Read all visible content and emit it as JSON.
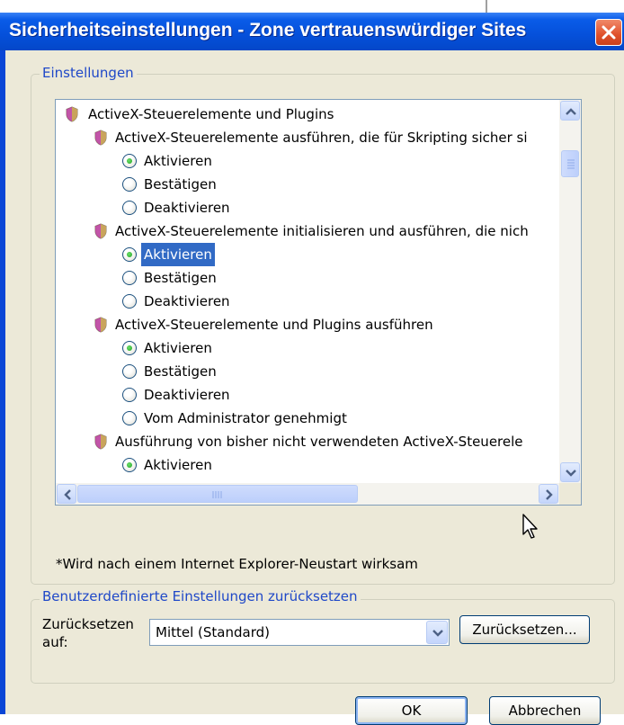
{
  "window": {
    "title": "Sicherheitseinstellungen - Zone vertrauenswürdiger Sites",
    "close_icon": "close-x-icon"
  },
  "settings_group": {
    "legend": "Einstellungen",
    "tree": [
      {
        "type": "category",
        "label": "ActiveX-Steuerelemente und Plugins",
        "icon": "shield-icon"
      },
      {
        "type": "setting",
        "label": "ActiveX-Steuerelemente ausführen, die für Skripting sicher si",
        "icon": "shield-icon"
      },
      {
        "type": "option",
        "label": "Aktivieren",
        "checked": true,
        "selected": false
      },
      {
        "type": "option",
        "label": "Bestätigen",
        "checked": false,
        "selected": false
      },
      {
        "type": "option",
        "label": "Deaktivieren",
        "checked": false,
        "selected": false
      },
      {
        "type": "setting",
        "label": "ActiveX-Steuerelemente initialisieren und ausführen, die nich",
        "icon": "shield-icon"
      },
      {
        "type": "option",
        "label": "Aktivieren",
        "checked": true,
        "selected": true
      },
      {
        "type": "option",
        "label": "Bestätigen",
        "checked": false,
        "selected": false
      },
      {
        "type": "option",
        "label": "Deaktivieren",
        "checked": false,
        "selected": false
      },
      {
        "type": "setting",
        "label": "ActiveX-Steuerelemente und Plugins ausführen",
        "icon": "shield-icon"
      },
      {
        "type": "option",
        "label": "Aktivieren",
        "checked": true,
        "selected": false
      },
      {
        "type": "option",
        "label": "Bestätigen",
        "checked": false,
        "selected": false
      },
      {
        "type": "option",
        "label": "Deaktivieren",
        "checked": false,
        "selected": false
      },
      {
        "type": "option",
        "label": "Vom Administrator genehmigt",
        "checked": false,
        "selected": false
      },
      {
        "type": "setting",
        "label": "Ausführung von bisher nicht verwendeten ActiveX-Steuerele",
        "icon": "shield-icon"
      },
      {
        "type": "option",
        "label": "Aktivieren",
        "checked": true,
        "selected": false
      }
    ],
    "note": "*Wird nach einem Internet Explorer-Neustart wirksam"
  },
  "reset_group": {
    "legend": "Benutzerdefinierte Einstellungen zurücksetzen",
    "label": "Zurücksetzen auf:",
    "select_value": "Mittel (Standard)",
    "reset_button": "Zurücksetzen..."
  },
  "footer": {
    "ok": "OK",
    "cancel": "Abbrechen"
  },
  "colors": {
    "title_bar": "#0a5ce8",
    "legend_text": "#1f48c8",
    "selection": "#316ac5",
    "dialog_face": "#ece9d8"
  }
}
